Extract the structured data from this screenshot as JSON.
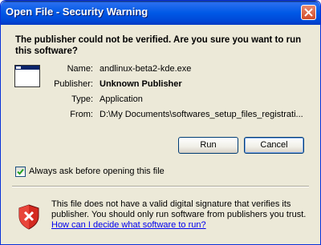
{
  "window": {
    "title": "Open File - Security Warning"
  },
  "question": "The publisher could not be verified.  Are you sure you want to run this software?",
  "details": {
    "name_label": "Name:",
    "name_value": "andlinux-beta2-kde.exe",
    "publisher_label": "Publisher:",
    "publisher_value": "Unknown Publisher",
    "type_label": "Type:",
    "type_value": "Application",
    "from_label": "From:",
    "from_value": "D:\\My Documents\\softwares_setup_files_registrati..."
  },
  "buttons": {
    "run": "Run",
    "cancel": "Cancel"
  },
  "checkbox": {
    "label": "Always ask before opening this file",
    "checked": true
  },
  "warning": {
    "text": "This file does not have a valid digital signature that verifies its publisher.  You should only run software from publishers you trust.",
    "link": "How can I decide what software to run?"
  },
  "icons": {
    "close": "close-icon",
    "app": "application-window-icon",
    "shield": "security-shield-icon",
    "check": "checkmark-icon"
  }
}
